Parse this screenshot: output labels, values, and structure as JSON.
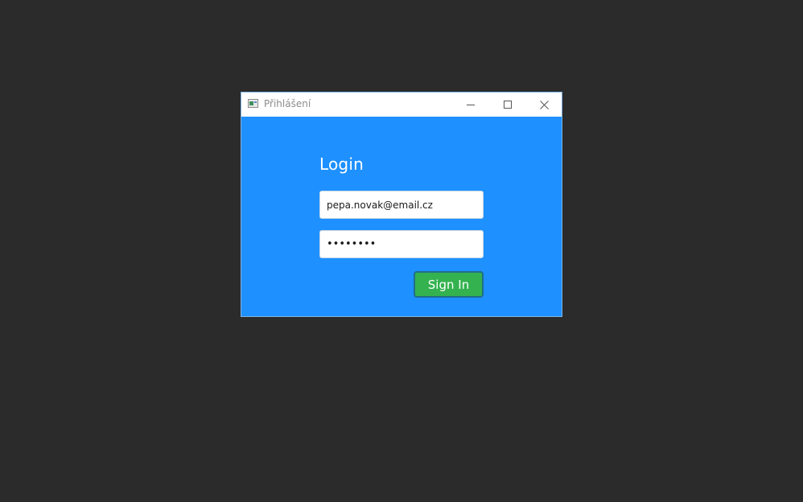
{
  "window": {
    "title": "Přihlášení",
    "controls": {
      "minimize_icon": "minimize-icon",
      "maximize_icon": "maximize-icon",
      "close_icon": "close-icon"
    }
  },
  "login": {
    "heading": "Login",
    "email_value": "pepa.novak@email.cz",
    "password_value": "••••••••",
    "sign_in_label": "Sign In"
  },
  "colors": {
    "desktop_background": "#2b2b2b",
    "panel_background": "#1e90ff",
    "button_background": "#34b24f",
    "button_border": "#1f6f8a",
    "heading_text": "#ffffff",
    "titlebar_text": "#8c8c8c"
  }
}
